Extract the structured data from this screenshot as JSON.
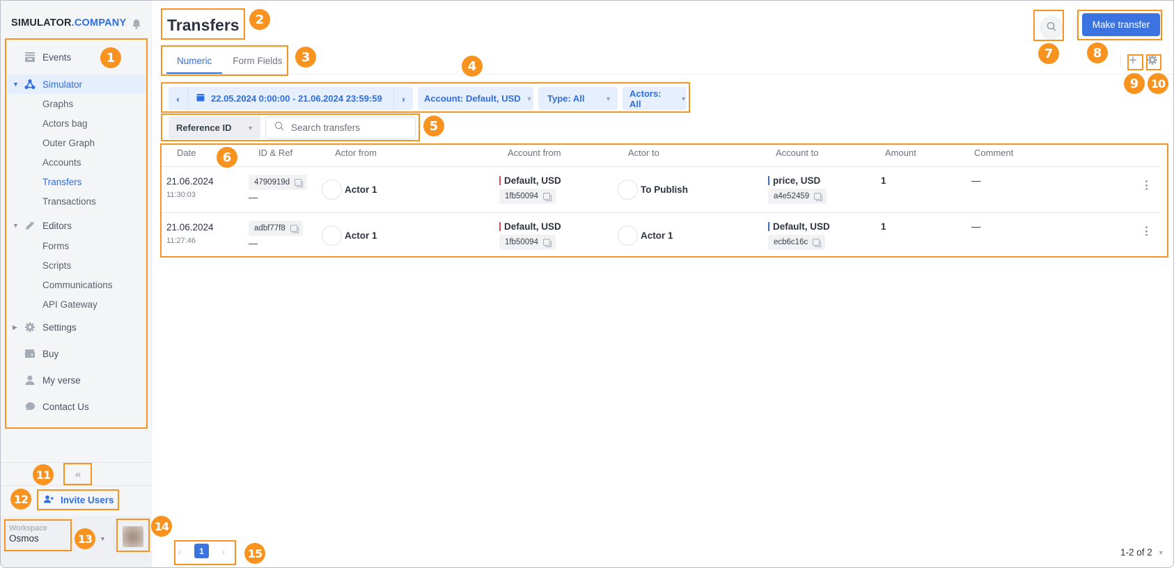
{
  "sidebar": {
    "brand_main": "SIMULATOR",
    "brand_accent": ".COMPANY",
    "nav": [
      {
        "label": "Events",
        "icon": "events-icon"
      },
      {
        "label": "Simulator",
        "icon": "simulator-icon",
        "expanded": true,
        "active": true
      },
      {
        "label": "Editors",
        "icon": "pencil-icon",
        "expanded": true
      },
      {
        "label": "Settings",
        "icon": "gear-icon",
        "expanded": false
      },
      {
        "label": "Buy",
        "icon": "wallet-icon"
      },
      {
        "label": "My verse",
        "icon": "user-icon"
      },
      {
        "label": "Contact Us",
        "icon": "chat-icon"
      }
    ],
    "simulator_children": [
      "Graphs",
      "Actors bag",
      "Outer Graph",
      "Accounts",
      "Transfers",
      "Transactions"
    ],
    "editors_children": [
      "Forms",
      "Scripts",
      "Communications",
      "API Gateway"
    ],
    "collapse_label": "«",
    "invite_label": "Invite Users",
    "workspace_label": "Workspace",
    "workspace_value": "Osmos"
  },
  "header": {
    "title": "Transfers",
    "make_transfer_label": "Make transfer",
    "tabs": [
      {
        "label": "Numeric",
        "active": true
      },
      {
        "label": "Form Fields",
        "active": false
      }
    ]
  },
  "filters": {
    "date_range": "22.05.2024 0:00:00 - 21.06.2024 23:59:59",
    "account": "Account: Default, USD",
    "type": "Type: All",
    "actors": "Actors: All",
    "search_field": "Reference ID",
    "search_placeholder": "Search transfers",
    "search_value": ""
  },
  "table": {
    "columns": [
      "Date",
      "ID & Ref",
      "Actor from",
      "Account from",
      "Actor to",
      "Account to",
      "Amount",
      "Comment"
    ],
    "rows": [
      {
        "date": "21.06.2024",
        "time": "11:30:03",
        "id": "4790919d",
        "ref": "—",
        "actor_from": "Actor 1",
        "account_from": "Default, USD",
        "account_from_id": "1fb50094",
        "actor_to": "To Publish",
        "account_to": "price, USD",
        "account_to_id": "a4e52459",
        "amount": "1",
        "comment": "—"
      },
      {
        "date": "21.06.2024",
        "time": "11:27:46",
        "id": "adbf77f8",
        "ref": "—",
        "actor_from": "Actor 1",
        "account_from": "Default, USD",
        "account_from_id": "1fb50094",
        "actor_to": "Actor 1",
        "account_to": "Default, USD",
        "account_to_id": "ecb6c16c",
        "amount": "1",
        "comment": "—"
      }
    ]
  },
  "pagination": {
    "current_page": "1",
    "summary": "1-2 of 2"
  },
  "colors": {
    "accent": "#2e6ee0",
    "primary_button": "#3b74e0",
    "account_from_marker": "#e5484d",
    "account_to_marker": "#2e6ee0",
    "annotation": "#f7931e"
  },
  "annotations": [
    "1",
    "2",
    "3",
    "4",
    "5",
    "6",
    "7",
    "8",
    "9",
    "10",
    "11",
    "12",
    "13",
    "14",
    "15"
  ]
}
